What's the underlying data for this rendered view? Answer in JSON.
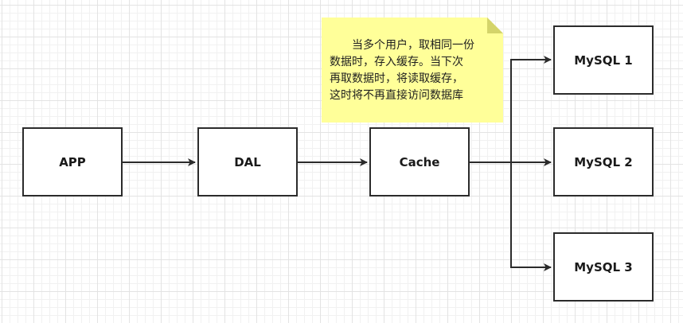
{
  "diagram": {
    "nodes": {
      "app": "APP",
      "dal": "DAL",
      "cache": "Cache",
      "mysql1": "MySQL 1",
      "mysql2": "MySQL 2",
      "mysql3": "MySQL 3"
    },
    "note": {
      "lines": [
        "当多个用户，取相同一份",
        "数据时，存入缓存。当下次",
        "再取数据时，将读取缓存，",
        "这时将不再直接访问数据库"
      ]
    },
    "edges": [
      {
        "from": "APP",
        "to": "DAL"
      },
      {
        "from": "DAL",
        "to": "Cache"
      },
      {
        "from": "Cache",
        "to": "MySQL 1"
      },
      {
        "from": "Cache",
        "to": "MySQL 2"
      },
      {
        "from": "Cache",
        "to": "MySQL 3"
      }
    ],
    "colors": {
      "note_fill": "#ffff99",
      "note_fold": "#d4d46a",
      "stroke": "#2b2b2b"
    }
  }
}
